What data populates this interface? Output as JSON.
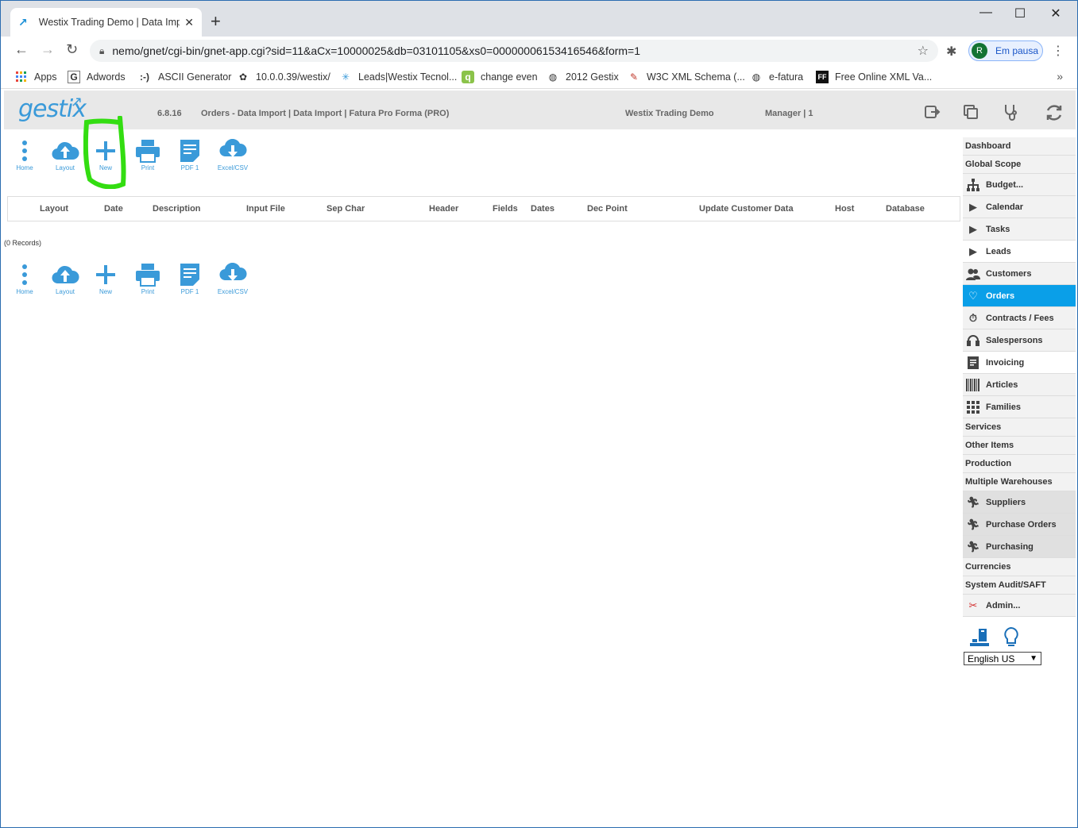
{
  "browser": {
    "tab_title": "Westix Trading Demo | Data Impo",
    "url": "nemo/gnet/cgi-bin/gnet-app.cgi?sid=11&aCx=10000025&db=03101105&xs0=00000006153416546&form=1",
    "profile_initial": "R",
    "profile_label": "Em pausa",
    "bookmarks": [
      {
        "label": "Apps",
        "icon": "apps-grid-icon"
      },
      {
        "label": "Adwords",
        "icon": "g-icon"
      },
      {
        "label": "ASCII Generator",
        "icon": "emoticon-icon"
      },
      {
        "label": "10.0.0.39/westix/",
        "icon": "flower-icon"
      },
      {
        "label": "Leads|Westix Tecnol...",
        "icon": "spark-icon"
      },
      {
        "label": "change even",
        "icon": "q-icon"
      },
      {
        "label": "2012 Gestix",
        "icon": "globe-icon"
      },
      {
        "label": "W3C XML Schema (...",
        "icon": "tool-icon"
      },
      {
        "label": "e-fatura",
        "icon": "globe-icon"
      },
      {
        "label": "Free Online XML Va...",
        "icon": "ff-icon"
      }
    ]
  },
  "app": {
    "logo": "gestix",
    "version": "6.8.16",
    "breadcrumb": "Orders - Data Import | Data Import | Fatura Pro Forma (PRO)",
    "company": "Westix Trading Demo",
    "user": "Manager | 1",
    "toolbar": [
      {
        "label": "Home",
        "icon": "dots-vertical-icon"
      },
      {
        "label": "Layout",
        "icon": "cloud-upload-icon"
      },
      {
        "label": "New",
        "icon": "plus-icon"
      },
      {
        "label": "Print",
        "icon": "printer-icon"
      },
      {
        "label": "PDF 1",
        "icon": "document-icon"
      },
      {
        "label": "Excel/CSV",
        "icon": "cloud-download-icon"
      }
    ],
    "columns": [
      "Layout",
      "Date",
      "Description",
      "Input File",
      "Sep Char",
      "Header",
      "Fields",
      "Dates",
      "Dec Point",
      "Update Customer Data",
      "Host",
      "Database"
    ],
    "records_text": "(0 Records)",
    "language": "English US"
  },
  "sidemenu": [
    {
      "label": "Dashboard",
      "icon": "",
      "style": "plain"
    },
    {
      "label": "Global Scope",
      "icon": "",
      "style": "plain"
    },
    {
      "label": "Budget...",
      "icon": "org-chart-icon",
      "style": "ico"
    },
    {
      "label": "Calendar",
      "icon": "play-icon",
      "style": "ico"
    },
    {
      "label": "Tasks",
      "icon": "play-icon",
      "style": "ico"
    },
    {
      "label": "Leads",
      "icon": "play-icon",
      "style": "ico-white"
    },
    {
      "label": "Customers",
      "icon": "users-icon",
      "style": "ico"
    },
    {
      "label": "Orders",
      "icon": "heart-icon",
      "style": "active"
    },
    {
      "label": "Contracts / Fees",
      "icon": "stopwatch-icon",
      "style": "ico"
    },
    {
      "label": "Salespersons",
      "icon": "headset-icon",
      "style": "ico"
    },
    {
      "label": "Invoicing",
      "icon": "invoice-icon",
      "style": "ico-white"
    },
    {
      "label": "Articles",
      "icon": "barcode-icon",
      "style": "ico"
    },
    {
      "label": "Families",
      "icon": "grid-icon",
      "style": "ico"
    },
    {
      "label": "Services",
      "icon": "",
      "style": "plain"
    },
    {
      "label": "Other Items",
      "icon": "",
      "style": "plain"
    },
    {
      "label": "Production",
      "icon": "",
      "style": "plain"
    },
    {
      "label": "Multiple Warehouses",
      "icon": "",
      "style": "plain"
    },
    {
      "label": "Suppliers",
      "icon": "runner-icon",
      "style": "ico-gray"
    },
    {
      "label": "Purchase Orders",
      "icon": "runner-icon",
      "style": "ico-gray"
    },
    {
      "label": "Purchasing",
      "icon": "runner-icon",
      "style": "ico-gray"
    },
    {
      "label": "Currencies",
      "icon": "",
      "style": "plain"
    },
    {
      "label": "System Audit/SAFT",
      "icon": "",
      "style": "plain"
    },
    {
      "label": "Admin...",
      "icon": "admin-icon",
      "style": "ico"
    }
  ]
}
